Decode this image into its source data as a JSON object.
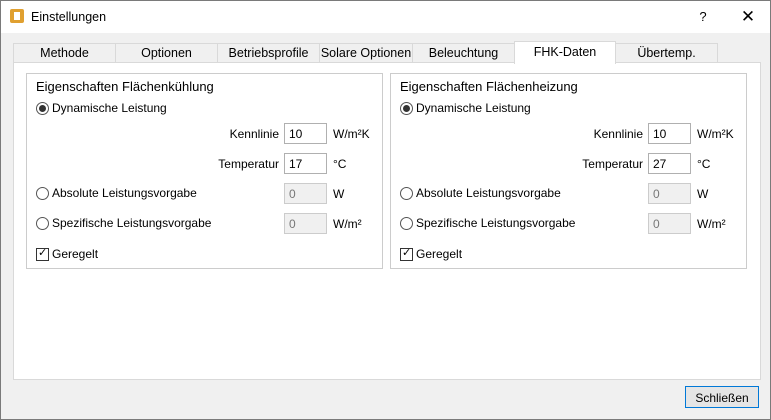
{
  "window": {
    "title": "Einstellungen",
    "help_glyph": "?",
    "close_glyph": "✕"
  },
  "tabs": [
    {
      "label": "Methode"
    },
    {
      "label": "Optionen"
    },
    {
      "label": "Betriebsprofile"
    },
    {
      "label": "Solare Optionen"
    },
    {
      "label": "Beleuchtung"
    },
    {
      "label": "FHK-Daten",
      "active": true
    },
    {
      "label": "Übertemp."
    }
  ],
  "cooling": {
    "title": "Eigenschaften Flächenkühlung",
    "dynamic_label": "Dynamische Leistung",
    "kennlinie_label": "Kennlinie",
    "kennlinie_value": "10",
    "kennlinie_unit": "W/m²K",
    "temperatur_label": "Temperatur",
    "temperatur_value": "17",
    "temperatur_unit": "°C",
    "absolute_label": "Absolute Leistungsvorgabe",
    "absolute_value": "0",
    "absolute_unit": "W",
    "specific_label": "Spezifische Leistungsvorgabe",
    "specific_value": "0",
    "specific_unit": "W/m²",
    "geregelt_label": "Geregelt",
    "geregelt_checked": true
  },
  "heating": {
    "title": "Eigenschaften Flächenheizung",
    "dynamic_label": "Dynamische Leistung",
    "kennlinie_label": "Kennlinie",
    "kennlinie_value": "10",
    "kennlinie_unit": "W/m²K",
    "temperatur_label": "Temperatur",
    "temperatur_value": "27",
    "temperatur_unit": "°C",
    "absolute_label": "Absolute Leistungsvorgabe",
    "absolute_value": "0",
    "absolute_unit": "W",
    "specific_label": "Spezifische Leistungsvorgabe",
    "specific_value": "0",
    "specific_unit": "W/m²",
    "geregelt_label": "Geregelt",
    "geregelt_checked": true
  },
  "footer": {
    "close_label": "Schließen"
  }
}
